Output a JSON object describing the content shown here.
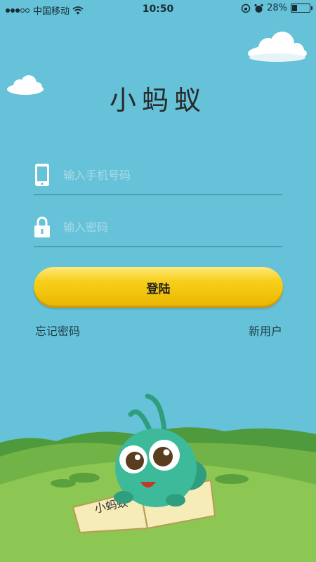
{
  "status_bar": {
    "carrier": "中国移动",
    "time": "10:50",
    "battery_percent": "28%"
  },
  "app": {
    "title": "小蚂蚁"
  },
  "login_form": {
    "phone_placeholder": "输入手机号码",
    "password_placeholder": "输入密码",
    "login_label": "登陆",
    "forgot_password_label": "忘记密码",
    "new_user_label": "新用户"
  },
  "illustration": {
    "book_text": "小蚂蚁"
  },
  "colors": {
    "sky": "#65c2d9",
    "button": "#f2c40c",
    "grass": "#8cc653",
    "mascot": "#3dba9a"
  },
  "icons": {
    "phone": "phone-icon",
    "lock": "lock-icon",
    "wifi": "wifi-icon",
    "alarm": "alarm-icon",
    "battery": "battery-icon"
  }
}
